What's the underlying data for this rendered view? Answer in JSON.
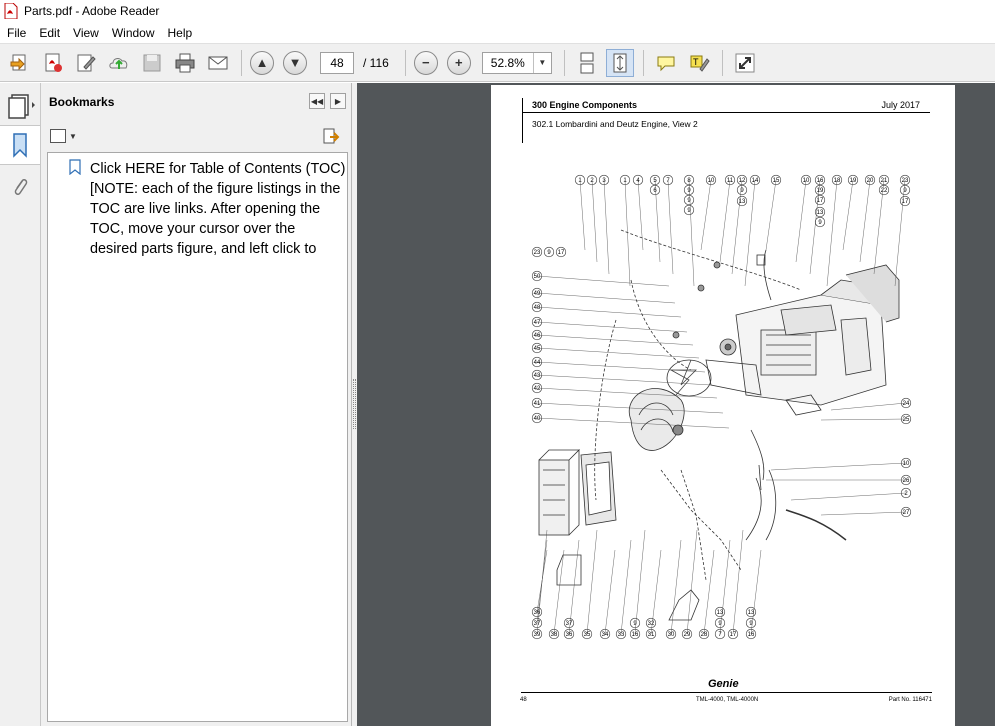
{
  "window": {
    "title": "Parts.pdf - Adobe Reader"
  },
  "menu": [
    "File",
    "Edit",
    "View",
    "Window",
    "Help"
  ],
  "toolbar": {
    "page_current": "48",
    "page_total": "/ 116",
    "zoom": "52.8%"
  },
  "bookmarks": {
    "title": "Bookmarks",
    "items": [
      {
        "label": "Click HERE for Table of Contents (TOC) [NOTE: each of the figure listings in the TOC are live links. After opening the TOC, move your cursor over the desired parts figure, and left click to"
      }
    ]
  },
  "document": {
    "header_title": "300 Engine Components",
    "header_date": "July 2017",
    "subtitle": "302.1 Lombardini and Deutz Engine, View 2",
    "footer_page": "48",
    "footer_models": "TML-4000, TML-4000N",
    "footer_partno": "Part No. 116471",
    "logo": "Genie",
    "callouts_top": [
      "1",
      "2",
      "3",
      "1",
      "4",
      "5",
      "7",
      "8",
      "10",
      "11",
      "12",
      "14",
      "15",
      "10",
      "16",
      "18",
      "19",
      "20",
      "21",
      "23"
    ],
    "callouts_top2": [
      "6",
      "9",
      "9",
      "9",
      "19",
      "17",
      "22",
      "9"
    ],
    "callouts_top3": [
      "9",
      "13",
      "13",
      "9",
      "17"
    ],
    "callouts_left": [
      "23",
      "9",
      "17",
      "50",
      "49",
      "48",
      "47",
      "46",
      "45",
      "44",
      "43",
      "42",
      "41",
      "40"
    ],
    "callouts_right": [
      "24",
      "25",
      "10",
      "26",
      "2",
      "27"
    ],
    "callouts_bottom": [
      "36",
      "37",
      "39",
      "38",
      "36",
      "35",
      "34",
      "33",
      "16",
      "31",
      "30",
      "29",
      "28",
      "7",
      "17",
      "16"
    ]
  }
}
